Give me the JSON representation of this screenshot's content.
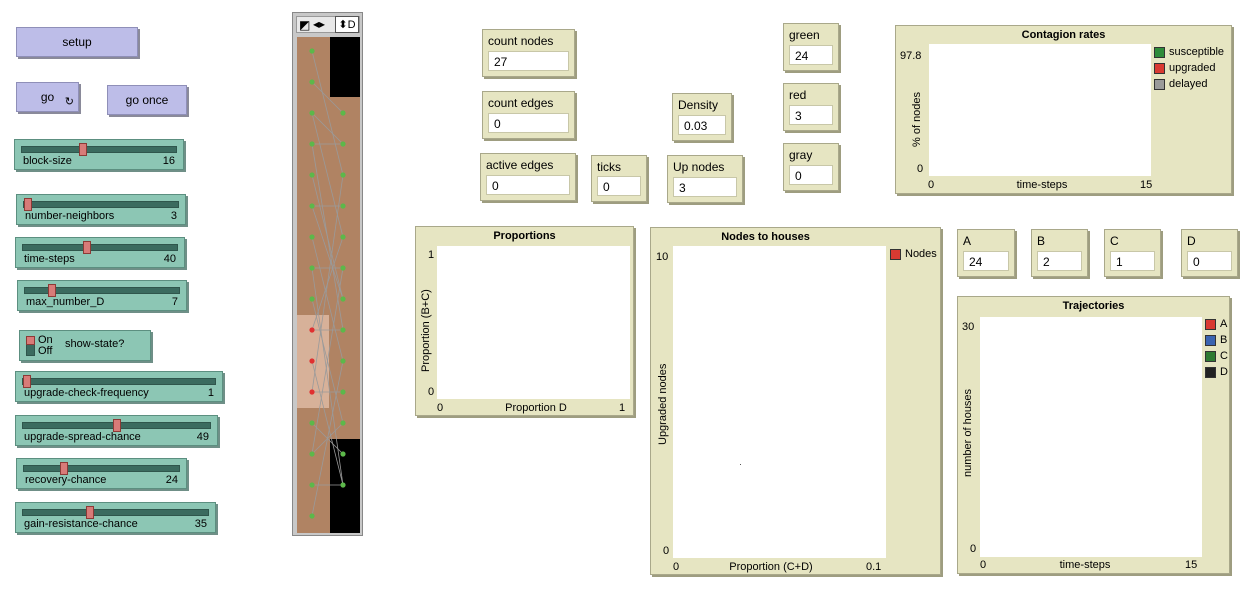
{
  "buttons": {
    "setup": "setup",
    "go": "go",
    "go_once": "go once",
    "forever_icon": "↻"
  },
  "sliders": [
    {
      "name": "block-size",
      "value": "16",
      "fraction": 0.38
    },
    {
      "name": "number-neighbors",
      "value": "3",
      "fraction": 0.0
    },
    {
      "name": "time-steps",
      "value": "40",
      "fraction": 0.4
    },
    {
      "name": "max_number_D",
      "value": "7",
      "fraction": 0.15
    },
    {
      "name": "upgrade-check-frequency",
      "value": "1",
      "fraction": 0.0
    },
    {
      "name": "upgrade-spread-chance",
      "value": "49",
      "fraction": 0.49
    },
    {
      "name": "recovery-chance",
      "value": "24",
      "fraction": 0.24
    },
    {
      "name": "gain-resistance-chance",
      "value": "35",
      "fraction": 0.35
    }
  ],
  "switch": {
    "label": "show-state?",
    "on": "On",
    "off": "Off"
  },
  "view_toolbar": {
    "letter": "D"
  },
  "monitors": {
    "count_nodes": {
      "label": "count nodes",
      "value": "27"
    },
    "count_edges": {
      "label": "count edges",
      "value": "0"
    },
    "active_edges": {
      "label": "active edges",
      "value": "0"
    },
    "ticks": {
      "label": "ticks",
      "value": "0"
    },
    "density": {
      "label": "Density",
      "value": "0.03"
    },
    "up_nodes": {
      "label": "Up nodes",
      "value": "3"
    },
    "green": {
      "label": "green",
      "value": "24"
    },
    "red": {
      "label": "red",
      "value": "3"
    },
    "gray": {
      "label": "gray",
      "value": "0"
    },
    "a": {
      "label": "A",
      "value": "24"
    },
    "b": {
      "label": "B",
      "value": "2"
    },
    "c": {
      "label": "C",
      "value": "1"
    },
    "d": {
      "label": "D",
      "value": "0"
    }
  },
  "plots": {
    "contagion": {
      "title": "Contagion rates",
      "ylabel": "% of nodes",
      "xlabel": "time-steps",
      "ymax": "97.8",
      "ymin": "0",
      "xmin": "0",
      "xmax": "15",
      "legend": [
        {
          "name": "susceptible",
          "color": "#2e8b3a"
        },
        {
          "name": "upgraded",
          "color": "#d93a32"
        },
        {
          "name": "delayed",
          "color": "#9a9a9a"
        }
      ]
    },
    "proportions": {
      "title": "Proportions",
      "ylabel": "Proportion (B+C)",
      "xlabel": "Proportion D",
      "ymax": "1",
      "ymin": "0",
      "xmin": "0",
      "xmax": "1"
    },
    "nodes_houses": {
      "title": "Nodes to houses",
      "ylabel": "Upgraded nodes",
      "xlabel": "Proportion (C+D)",
      "ymax": "10",
      "ymin": "0",
      "xmin": "0",
      "xmax": "0.1",
      "legend": [
        {
          "name": "Nodes",
          "color": "#d93a32"
        }
      ]
    },
    "trajectories": {
      "title": "Trajectories",
      "ylabel": "number of houses",
      "xlabel": "time-steps",
      "ymax": "30",
      "ymin": "0",
      "xmin": "0",
      "xmax": "15",
      "legend": [
        {
          "name": "A",
          "color": "#d93a32"
        },
        {
          "name": "B",
          "color": "#3a64b0"
        },
        {
          "name": "C",
          "color": "#2e7a32"
        },
        {
          "name": "D",
          "color": "#222222"
        }
      ]
    }
  },
  "colors": {
    "node_green": "#5cb84a",
    "node_red": "#e03030",
    "patch_brown": "#b08363",
    "edge_gray": "#9a9a9a"
  }
}
